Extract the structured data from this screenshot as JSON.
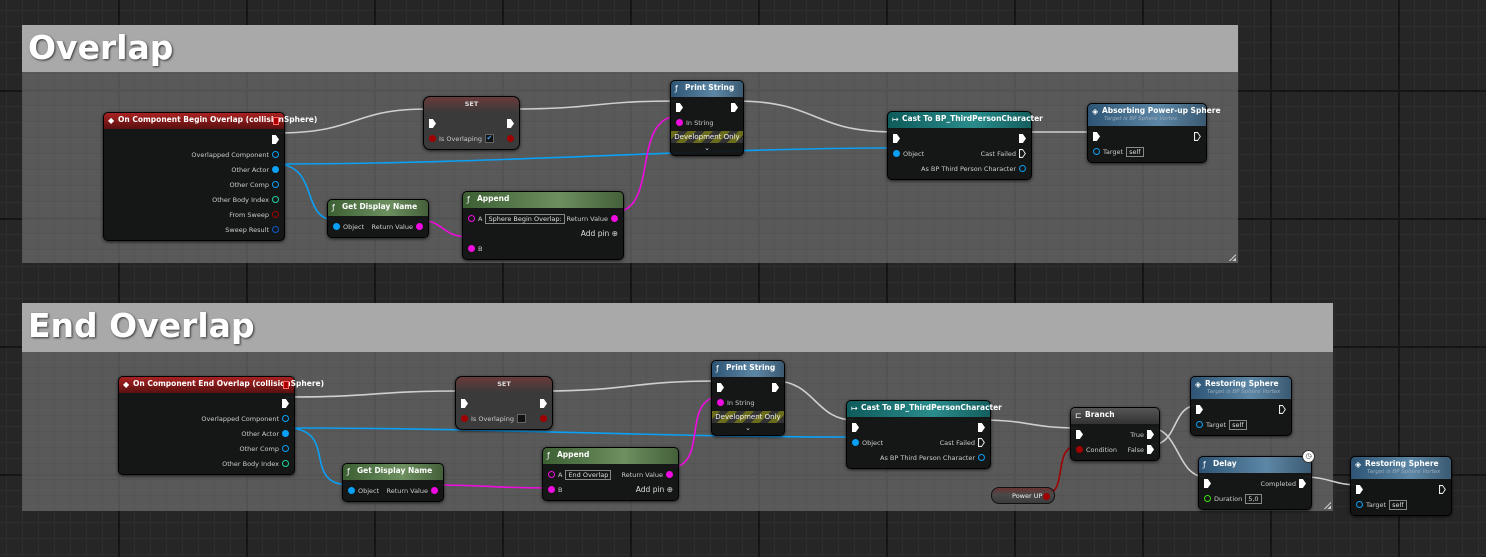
{
  "comments": [
    {
      "title": "Overlap"
    },
    {
      "title": "End Overlap"
    }
  ],
  "pin_colors": {
    "exec": "#ffffff",
    "object": "#0aa0f5",
    "string": "#f00ce0",
    "bool": "#a10000",
    "int": "#1ed6a0",
    "struct": "#0a5ac8",
    "float": "#3ce010"
  },
  "nodes": [
    {
      "id": "ov_event",
      "kind": "event",
      "title": "On Component Begin Overlap (collisionSphere)",
      "icon": "◆",
      "rows": [
        {
          "r": {
            "type": "exec"
          }
        },
        {
          "r": {
            "label": "Overlapped Component",
            "type": "object"
          }
        },
        {
          "r": {
            "label": "Other Actor",
            "type": "object",
            "filled": true
          }
        },
        {
          "r": {
            "label": "Other Comp",
            "type": "object"
          }
        },
        {
          "r": {
            "label": "Other Body Index",
            "type": "int"
          }
        },
        {
          "r": {
            "label": "From Sweep",
            "type": "bool"
          }
        },
        {
          "r": {
            "label": "Sweep Result",
            "type": "struct"
          }
        }
      ]
    },
    {
      "id": "ov_set",
      "kind": "set",
      "title": "SET",
      "rows": [
        {
          "l": {
            "type": "exec"
          },
          "r": {
            "type": "exec"
          }
        },
        {
          "l": {
            "label": "Is Overlaping",
            "type": "bool",
            "filled": true,
            "check": "✔"
          },
          "r": {
            "type": "bool",
            "filled": true
          }
        }
      ]
    },
    {
      "id": "ov_print",
      "kind": "func",
      "title": "Print String",
      "icon": "ƒ",
      "devonly": "Development Only",
      "chevron": "⌄",
      "rows": [
        {
          "l": {
            "type": "exec"
          },
          "r": {
            "type": "exec"
          }
        },
        {
          "l": {
            "label": "In String",
            "type": "string",
            "filled": true
          }
        }
      ]
    },
    {
      "id": "ov_cast",
      "kind": "cast",
      "title": "Cast To BP_ThirdPersonCharacter",
      "icon": "↦",
      "rows": [
        {
          "l": {
            "type": "exec"
          },
          "r": {
            "type": "exec"
          }
        },
        {
          "l": {
            "label": "Object",
            "type": "object",
            "filled": true
          },
          "r": {
            "label": "Cast Failed",
            "type": "exec",
            "open": true
          }
        },
        {
          "r": {
            "label": "As BP Third Person Character",
            "type": "object"
          }
        }
      ]
    },
    {
      "id": "ov_absorb",
      "kind": "func",
      "title": "Absorbing Power-up Sphere",
      "subtitle": "Target is BP Sphere Vortex",
      "icon": "◈",
      "rows": [
        {
          "l": {
            "type": "exec"
          },
          "r": {
            "type": "exec",
            "open": true
          }
        },
        {
          "l": {
            "label": "Target",
            "type": "object",
            "value": "self"
          }
        }
      ]
    },
    {
      "id": "ov_gdn",
      "kind": "pure",
      "title": "Get Display Name",
      "icon": "ƒ",
      "rows": [
        {
          "l": {
            "label": "Object",
            "type": "object",
            "filled": true
          },
          "r": {
            "label": "Return Value",
            "type": "string",
            "filled": true
          }
        }
      ]
    },
    {
      "id": "ov_append",
      "kind": "pure",
      "title": "Append",
      "icon": "ƒ",
      "rows": [
        {
          "l": {
            "label": "A",
            "type": "string",
            "value": "Sphere Begin Overlap:"
          },
          "r": {
            "label": "Return Value",
            "type": "string",
            "filled": true
          }
        },
        {
          "r": {
            "label": "Add pin",
            "addpin": "⊕"
          }
        },
        {
          "l": {
            "label": "B",
            "type": "string",
            "filled": true
          }
        }
      ]
    },
    {
      "id": "eo_event",
      "kind": "event",
      "title": "On Component End Overlap (collisionSphere)",
      "icon": "◆",
      "rows": [
        {
          "r": {
            "type": "exec"
          }
        },
        {
          "r": {
            "label": "Overlapped Component",
            "type": "object"
          }
        },
        {
          "r": {
            "label": "Other Actor",
            "type": "object",
            "filled": true
          }
        },
        {
          "r": {
            "label": "Other Comp",
            "type": "object"
          }
        },
        {
          "r": {
            "label": "Other Body Index",
            "type": "int"
          }
        }
      ]
    },
    {
      "id": "eo_set",
      "kind": "set",
      "title": "SET",
      "rows": [
        {
          "l": {
            "type": "exec"
          },
          "r": {
            "type": "exec"
          }
        },
        {
          "l": {
            "label": "Is Overlaping",
            "type": "bool",
            "filled": true,
            "check": ""
          },
          "r": {
            "type": "bool",
            "filled": true
          }
        }
      ]
    },
    {
      "id": "eo_print",
      "kind": "func",
      "title": "Print String",
      "icon": "ƒ",
      "devonly": "Development Only",
      "chevron": "⌄",
      "rows": [
        {
          "l": {
            "type": "exec"
          },
          "r": {
            "type": "exec"
          }
        },
        {
          "l": {
            "label": "In String",
            "type": "string",
            "filled": true
          }
        }
      ]
    },
    {
      "id": "eo_cast",
      "kind": "cast",
      "title": "Cast To BP_ThirdPersonCharacter",
      "icon": "↦",
      "rows": [
        {
          "l": {
            "type": "exec"
          },
          "r": {
            "type": "exec"
          }
        },
        {
          "l": {
            "label": "Object",
            "type": "object",
            "filled": true
          },
          "r": {
            "label": "Cast Failed",
            "type": "exec",
            "open": true
          }
        },
        {
          "r": {
            "label": "As BP Third Person Character",
            "type": "object"
          }
        }
      ]
    },
    {
      "id": "eo_branch",
      "kind": "macro",
      "title": "Branch",
      "icon": "⊏",
      "rows": [
        {
          "l": {
            "type": "exec"
          },
          "r": {
            "label": "True",
            "type": "exec"
          }
        },
        {
          "l": {
            "label": "Condition",
            "type": "bool",
            "filled": true
          },
          "r": {
            "label": "False",
            "type": "exec"
          }
        }
      ]
    },
    {
      "id": "eo_restore1",
      "kind": "func",
      "title": "Restoring Sphere",
      "subtitle": "Target is BP Sphere Vortex",
      "icon": "◈",
      "rows": [
        {
          "l": {
            "type": "exec"
          },
          "r": {
            "type": "exec",
            "open": true
          }
        },
        {
          "l": {
            "label": "Target",
            "type": "object",
            "value": "self"
          }
        }
      ]
    },
    {
      "id": "eo_delay",
      "kind": "func",
      "title": "Delay",
      "icon": "ƒ",
      "clock": "🕒",
      "rows": [
        {
          "l": {
            "type": "exec"
          },
          "r": {
            "label": "Completed",
            "type": "exec"
          }
        },
        {
          "l": {
            "label": "Duration",
            "type": "float",
            "value": "5,0"
          }
        }
      ]
    },
    {
      "id": "eo_restore2",
      "kind": "func",
      "title": "Restoring Sphere",
      "subtitle": "Target is BP Sphere Vortex",
      "icon": "◈",
      "rows": [
        {
          "l": {
            "type": "exec"
          },
          "r": {
            "type": "exec",
            "open": true
          }
        },
        {
          "l": {
            "label": "Target",
            "type": "object",
            "value": "self"
          }
        }
      ]
    },
    {
      "id": "eo_gdn",
      "kind": "pure",
      "title": "Get Display Name",
      "icon": "ƒ",
      "rows": [
        {
          "l": {
            "label": "Object",
            "type": "object",
            "filled": true
          },
          "r": {
            "label": "Return Value",
            "type": "string",
            "filled": true
          }
        }
      ]
    },
    {
      "id": "eo_append",
      "kind": "pure",
      "title": "Append",
      "icon": "ƒ",
      "rows": [
        {
          "l": {
            "label": "A",
            "type": "string",
            "value": "End Overlap"
          },
          "r": {
            "label": "Return Value",
            "type": "string",
            "filled": true
          }
        },
        {
          "l": {
            "label": "B",
            "type": "string",
            "filled": true
          },
          "r": {
            "label": "Add pin",
            "addpin": "⊕"
          }
        }
      ]
    }
  ],
  "variable_nodes": [
    {
      "label": "Power UP",
      "type": "bool"
    }
  ]
}
